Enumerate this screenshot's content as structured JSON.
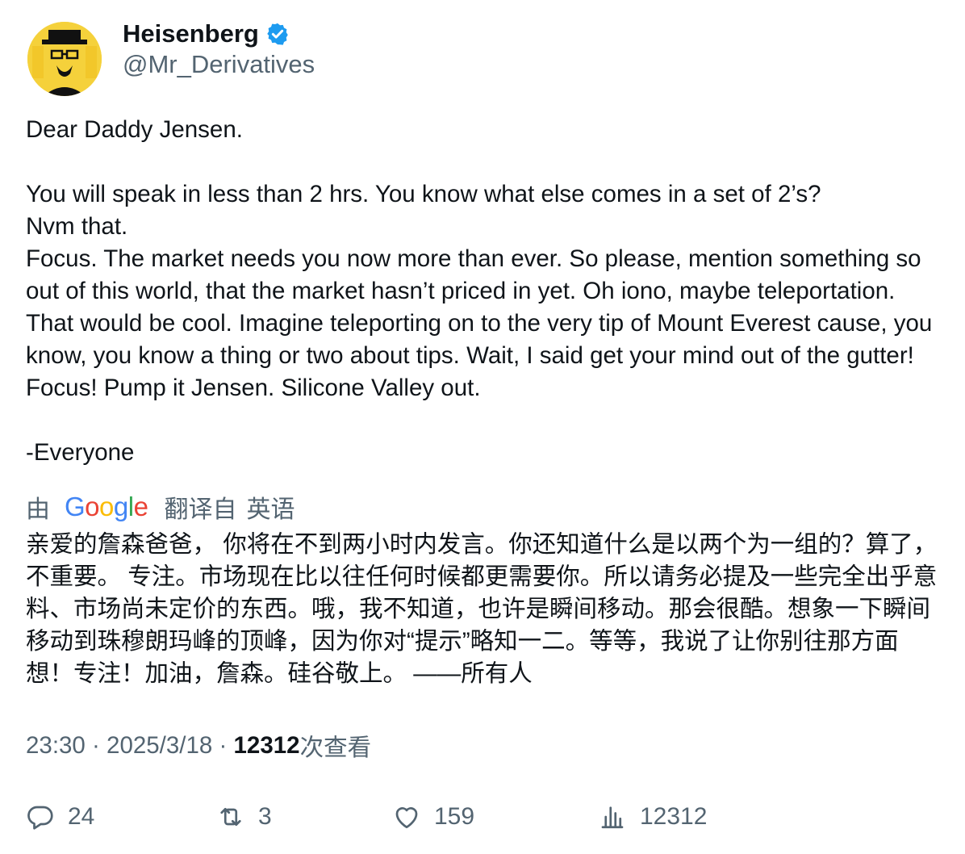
{
  "author": {
    "display_name": "Heisenberg",
    "handle": "@Mr_Derivatives",
    "verified_icon": "verified-badge-icon",
    "verified_color": "#1d9bf0",
    "avatar_color": "#f5d13b"
  },
  "tweet": {
    "paragraphs": [
      "Dear Daddy Jensen.",
      "",
      "You will speak in less than 2 hrs. You know what else comes in a set of 2’s?\nNvm that.\nFocus. The market needs you now more than ever. So please, mention something so out of this world, that the market hasn’t priced in yet. Oh iono, maybe teleportation. That would be cool. Imagine teleporting on to the very tip of Mount Everest cause, you know, you know a thing or two about tips. Wait, I said get your mind out of the gutter! Focus! Pump it Jensen. Silicone Valley out.",
      "",
      "-Everyone"
    ]
  },
  "translation": {
    "by_label": "由",
    "provider": "Google",
    "translated_from_label": "翻译自",
    "source_language": "英语",
    "text": "亲爱的詹森爸爸， 你将在不到两小时内发言。你还知道什么是以两个为一组的？算了，不重要。 专注。市场现在比以往任何时候都更需要你。所以请务必提及一些完全出乎意料、市场尚未定价的东西。哦，我不知道，也许是瞬间移动。那会很酷。想象一下瞬间移动到珠穆朗玛峰的顶峰，因为你对“提示”略知一二。等等，我说了让你别往那方面想！专注！加油，詹森。硅谷敬上。 ——所有人"
  },
  "meta": {
    "time": "23:30",
    "separator1": " · ",
    "date": "2025/3/18",
    "separator2": " · ",
    "views_count": "12312",
    "views_label": "次查看"
  },
  "actions": {
    "replies": {
      "icon": "reply-icon",
      "count": "24"
    },
    "retweets": {
      "icon": "retweet-icon",
      "count": "3"
    },
    "likes": {
      "icon": "heart-icon",
      "count": "159"
    },
    "views": {
      "icon": "analytics-icon",
      "count": "12312"
    }
  }
}
